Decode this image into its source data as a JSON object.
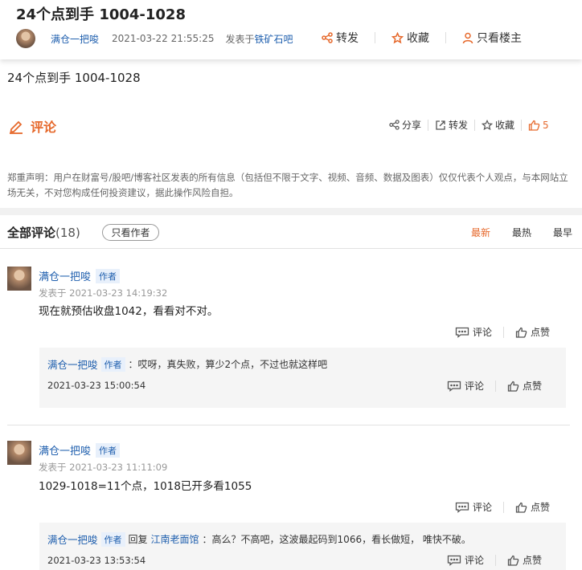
{
  "post": {
    "title": "24个点到手 1004-1028",
    "author": "满仓一把唆",
    "time": "2021-03-22 21:55:25",
    "posted_in_prefix": "发表于",
    "bar": "铁矿石吧",
    "body": "24个点到手 1004-1028"
  },
  "header_actions": {
    "forward": "转发",
    "favorite": "收藏",
    "author_only": "只看楼主"
  },
  "comment_bar": {
    "label": "评论",
    "share": "分享",
    "forward": "转发",
    "favorite": "收藏",
    "likes": "5"
  },
  "disclaimer": "郑重声明：用户在财富号/股吧/博客社区发表的所有信息（包括但不限于文字、视频、音频、数据及图表）仅仅代表个人观点，与本网站立场无关，不对您构成任何投资建议，据此操作风险自担。",
  "comments_header": {
    "label": "全部评论",
    "count": "(18)",
    "only_author": "只看作者",
    "sort": [
      "最新",
      "最热",
      "最早"
    ]
  },
  "comments": [
    {
      "author": "满仓一把唆",
      "badge": "作者",
      "time": "发表于 2021-03-23 14:19:32",
      "text": "现在就预估收盘1042，看看对不对。",
      "reply_label": "评论",
      "like_label": "点赞",
      "reply": {
        "author": "满仓一把唆",
        "badge": "作者",
        "text": "：哎呀，真失败，算少2个点，不过也就这样吧",
        "time": "2021-03-23 15:00:54",
        "reply_label": "评论",
        "like_label": "点赞"
      }
    },
    {
      "author": "满仓一把唆",
      "badge": "作者",
      "time": "发表于 2021-03-23 11:11:09",
      "text": "1029-1018=11个点，1018已开多看1055",
      "reply_label": "评论",
      "like_label": "点赞",
      "reply": {
        "author": "满仓一把唆",
        "badge": "作者",
        "reply_word": "回复",
        "reply_to": "江南老面馆",
        "text": "：高么？不高吧，这波最起码到1066，看长做短， 唯快不破。",
        "time": "2021-03-23 13:53:54",
        "reply_label": "评论",
        "like_label": "点赞"
      }
    }
  ],
  "colors": {
    "accent": "#e6692c",
    "link": "#1f5fae"
  }
}
